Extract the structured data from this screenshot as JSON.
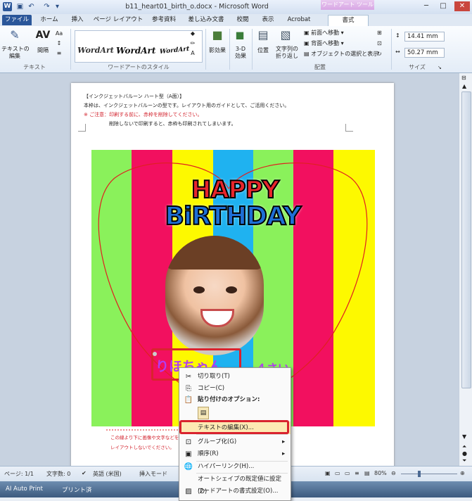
{
  "titlebar": {
    "title": "b11_heart01_birth_o.docx - Microsoft Word",
    "context_tool": "ワードアート ツール"
  },
  "tabs": [
    "ファイル",
    "ホーム",
    "挿入",
    "ページ レイアウト",
    "参考資料",
    "差し込み文書",
    "校閲",
    "表示",
    "Acrobat",
    "書式"
  ],
  "ribbon": {
    "text_group": {
      "edit_text": "テキストの\n編集",
      "spacing": "間隔",
      "label": "テキスト"
    },
    "wordart_group": {
      "samples": [
        "WordArt",
        "WordArt",
        "WordArt"
      ],
      "label": "ワードアートのスタイル"
    },
    "shadow": "影効果",
    "threed": "3-D\n効果",
    "arrange": {
      "position": "位置",
      "wrap": "文字列の\n折り返し",
      "bring_forward": "前面へ移動",
      "send_backward": "背面へ移動",
      "selection": "オブジェクトの選択と表示",
      "label": "配置"
    },
    "size": {
      "height": "14.41 mm",
      "width": "50.27 mm",
      "label": "サイズ"
    }
  },
  "page": {
    "line1": "【インクジェットバルーン ハート型（A面）】",
    "line2": "本枠は、インクジェットバルーンの型です。レイアウト用のガイドとして、ご活用ください。",
    "line3": "※ ご注意：印刷する前に、赤枠を削除してください。",
    "line4": "削除しないで印刷すると、赤枠も印刷されてしまいます。",
    "happy": "HAPPY",
    "birthday": "BiRTHDAY",
    "name": "りほちゃん",
    "age": "４さい",
    "note1": "この線より下に画像や文字などを",
    "note2": "レイアウトしないでください。"
  },
  "context_menu": {
    "cut": "切り取り(T)",
    "copy": "コピー(C)",
    "paste_options": "貼り付けのオプション:",
    "edit_text": "テキストの編集(X)...",
    "group": "グループ化(G)",
    "order": "順序(R)",
    "hyperlink": "ハイパーリンク(H)...",
    "set_default": "オートシェイプの既定値に設定(D)",
    "format": "ワードアートの書式設定(O)..."
  },
  "status": {
    "page": "ページ: 1/1",
    "words": "文字数: 0",
    "lang": "英語 (米国)",
    "mode": "挿入モード",
    "zoom": "80%"
  },
  "taskbar": {
    "item1": "AI Auto Print",
    "item2": "プリント済"
  }
}
